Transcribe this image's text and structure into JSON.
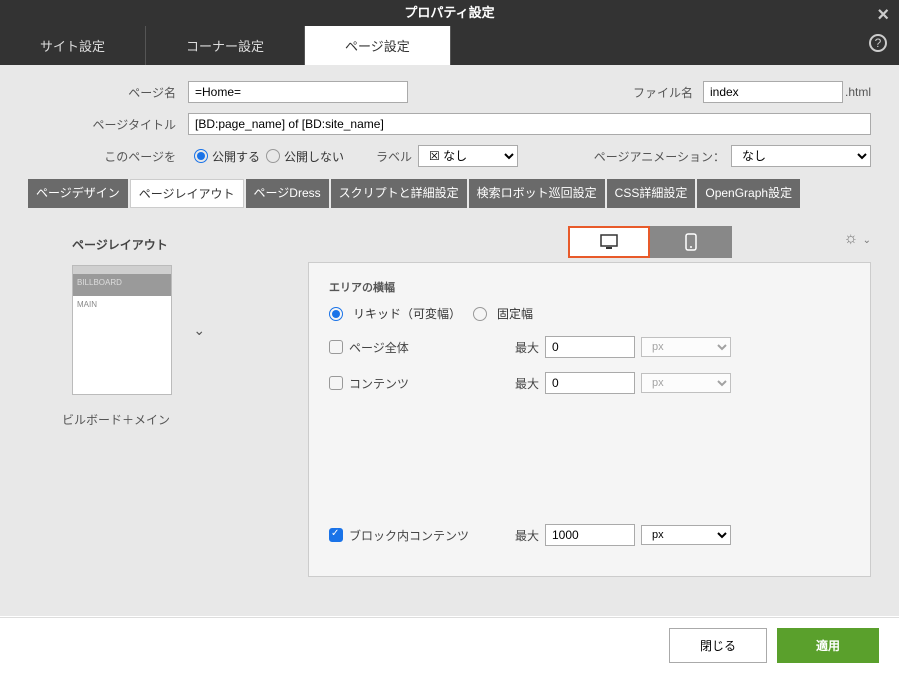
{
  "title": "プロパティ設定",
  "tabs": {
    "site": "サイト設定",
    "corner": "コーナー設定",
    "page": "ページ設定"
  },
  "form": {
    "page_name_label": "ページ名",
    "page_name_value": "=Home=",
    "file_name_label": "ファイル名",
    "file_name_value": "index",
    "file_ext": ".html",
    "page_title_label": "ページタイトル",
    "page_title_value": "[BD:page_name] of [BD:site_name]",
    "this_page_label": "このページを",
    "publish": "公開する",
    "unpublish": "公開しない",
    "label_label": "ラベル",
    "label_value": "☒ なし",
    "anim_label": "ページアニメーション：",
    "anim_value": "なし"
  },
  "subtabs": {
    "design": "ページデザイン",
    "layout": "ページレイアウト",
    "dress": "ページDress",
    "script": "スクリプトと詳細設定",
    "robot": "検索ロボット巡回設定",
    "css": "CSS詳細設定",
    "og": "OpenGraph設定"
  },
  "layout": {
    "title": "ページレイアウト",
    "billboard": "BILLBOARD",
    "main": "MAIN",
    "caption": "ビルボード＋メイン"
  },
  "area": {
    "section_title": "エリアの横幅",
    "liquid": "リキッド（可変幅）",
    "fixed": "固定幅",
    "whole_page": "ページ全体",
    "contents": "コンテンツ",
    "block_contents": "ブロック内コンテンツ",
    "max": "最大",
    "whole_val": "0",
    "contents_val": "0",
    "block_val": "1000",
    "px": "px"
  },
  "footer": {
    "close": "閉じる",
    "apply": "適用"
  }
}
